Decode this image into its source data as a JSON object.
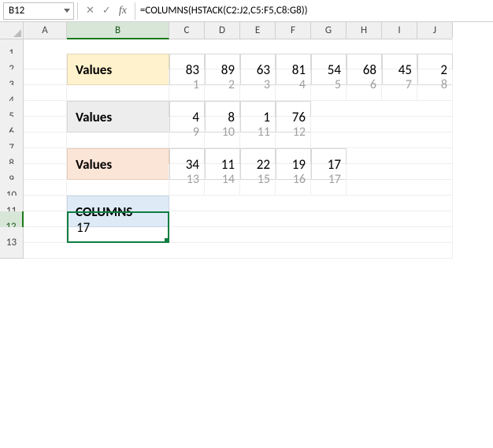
{
  "namebox": {
    "value": "B12"
  },
  "fb": {
    "cancel": "✕",
    "confirm": "✓",
    "fx": "fx"
  },
  "formula": "=COLUMNS(HSTACK(C2:J2,C5:F5,C8:G8))",
  "cols": [
    "A",
    "B",
    "C",
    "D",
    "E",
    "F",
    "G",
    "H",
    "I",
    "J"
  ],
  "rows": [
    "1",
    "2",
    "3",
    "4",
    "5",
    "6",
    "7",
    "8",
    "9",
    "10",
    "11",
    "12",
    "13"
  ],
  "block1": {
    "label": "Values",
    "vals": [
      "83",
      "89",
      "63",
      "81",
      "54",
      "68",
      "45",
      "2"
    ],
    "idx": [
      "1",
      "2",
      "3",
      "4",
      "5",
      "6",
      "7",
      "8"
    ]
  },
  "block2": {
    "label": "Values",
    "vals": [
      "4",
      "8",
      "1",
      "76"
    ],
    "idx": [
      "9",
      "10",
      "11",
      "12"
    ]
  },
  "block3": {
    "label": "Values",
    "vals": [
      "34",
      "11",
      "22",
      "19",
      "17"
    ],
    "idx": [
      "13",
      "14",
      "15",
      "16",
      "17"
    ]
  },
  "result": {
    "label": "COLUMNS",
    "value": "17"
  },
  "selected_col": "B",
  "selected_row": "12"
}
